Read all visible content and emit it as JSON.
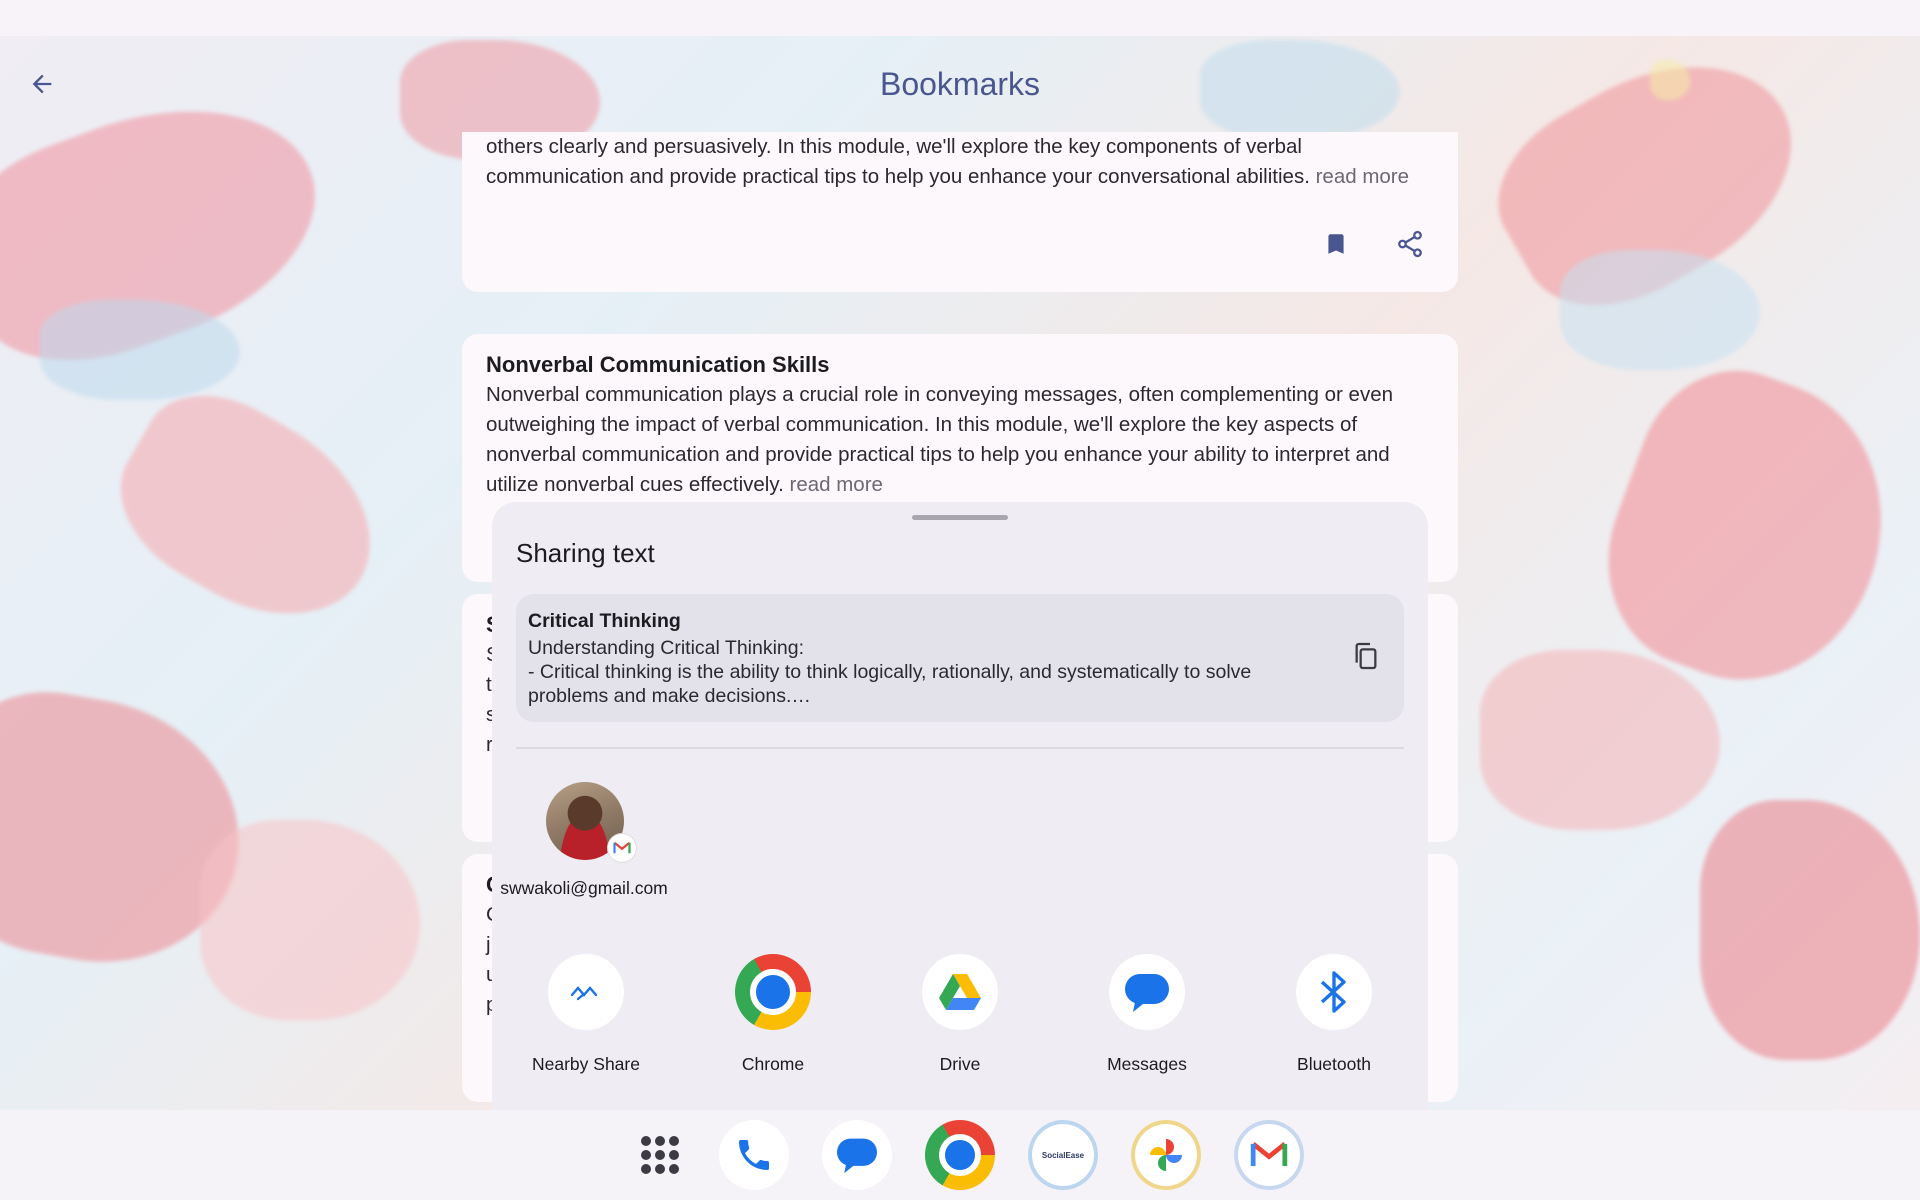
{
  "header": {
    "title": "Bookmarks"
  },
  "cards": [
    {
      "title": "",
      "body": "personal or professional life. It's an essential skill for conveying your thoughts, emotions, and ideas to others clearly and persuasively. In this module, we'll explore the key components of verbal communication and provide practical tips to help you enhance your conversational abilities.",
      "read_more": "read more"
    },
    {
      "title": "Nonverbal Communication Skills",
      "body": "Nonverbal communication plays a crucial role in conveying messages, often complementing or even outweighing the impact of verbal communication. In this module, we'll explore the key aspects of nonverbal communication and provide practical tips to help you enhance your ability to interpret and utilize nonverbal cues effectively.",
      "read_more": "read more"
    },
    {
      "title": "S",
      "lines": [
        "S",
        "t",
        "s",
        "r"
      ]
    },
    {
      "title": "C",
      "lines": [
        "C",
        "j",
        "u",
        "p"
      ]
    }
  ],
  "share_sheet": {
    "title": "Sharing text",
    "preview": {
      "title": "Critical Thinking",
      "text": "Understanding Critical Thinking:\n- Critical thinking is the ability to think logically, rationally, and systematically to solve problems and make decisions.…"
    },
    "contact": {
      "email": "swwakoli@gmail.com"
    },
    "apps": [
      {
        "label": "Nearby Share",
        "icon": "nearby-share-icon"
      },
      {
        "label": "Chrome",
        "icon": "chrome-icon"
      },
      {
        "label": "Drive",
        "icon": "drive-icon"
      },
      {
        "label": "Messages",
        "icon": "messages-icon"
      },
      {
        "label": "Bluetooth",
        "icon": "bluetooth-icon"
      }
    ]
  },
  "dock": {
    "items": [
      "app-drawer-icon",
      "phone-icon",
      "messages-icon",
      "chrome-icon",
      "socialease-icon",
      "photos-icon",
      "gmail-icon"
    ],
    "socialease_label": "SocialEase"
  },
  "colors": {
    "accent": "#4a5690",
    "sheet": "#efedf3",
    "card": "#fdf8fc"
  }
}
